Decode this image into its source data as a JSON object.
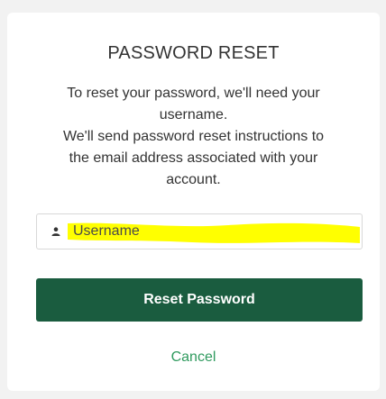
{
  "form": {
    "title": "PASSWORD RESET",
    "instructions": [
      "To reset your password, we'll need your",
      "username.",
      "We'll send password reset instructions to",
      "the email address associated with your",
      "account."
    ],
    "username": {
      "placeholder": "Username",
      "value": "",
      "icon": "user-icon",
      "highlight_color": "#ffff00"
    },
    "reset_button_label": "Reset Password",
    "cancel_label": "Cancel"
  },
  "colors": {
    "primary_button": "#1a5c3f",
    "link": "#2f9a5e",
    "background": "#f2f2f2"
  }
}
